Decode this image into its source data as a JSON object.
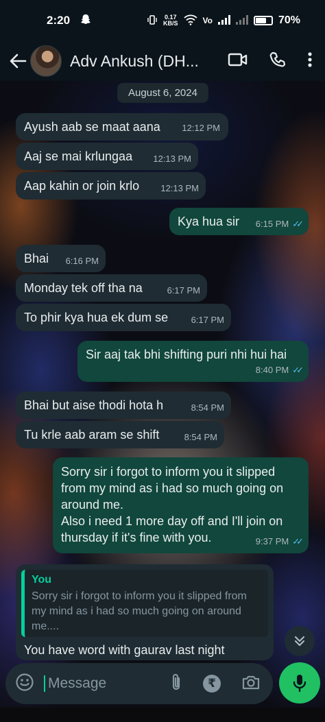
{
  "status_bar": {
    "time": "2:20",
    "snap_icon": "ghost",
    "net_speed_value": "0.17",
    "net_speed_unit": "KB/S",
    "vo_label": "Vo",
    "battery": "70%",
    "battery_level": 0.7
  },
  "header": {
    "contact_name": "Adv Ankush (DH...",
    "icons": [
      "back-arrow",
      "video-call",
      "voice-call",
      "more-options"
    ]
  },
  "date_chip": "August 6, 2024",
  "messages": [
    {
      "dir": "in",
      "text": "Ayush aab se maat aana",
      "time": "12:12 PM"
    },
    {
      "dir": "in",
      "text": "Aaj se mai krlungaa",
      "time": "12:13 PM"
    },
    {
      "dir": "in",
      "text": "Aap kahin or join krlo",
      "time": "12:13 PM"
    },
    {
      "dir": "out",
      "text": "Kya hua sir",
      "time": "6:15 PM",
      "ticks": "✓✓"
    },
    {
      "dir": "in",
      "text": "Bhai",
      "time": "6:16 PM"
    },
    {
      "dir": "in",
      "text": "Monday tek off tha na",
      "time": "6:17 PM"
    },
    {
      "dir": "in",
      "text": "To phir kya hua ek dum se",
      "time": "6:17 PM"
    },
    {
      "dir": "out",
      "text": "Sir aaj tak bhi shifting puri nhi hui hai",
      "time": "8:40 PM",
      "ticks": "✓✓"
    },
    {
      "dir": "in",
      "text": "Bhai but aise thodi hota h",
      "time": "8:54 PM"
    },
    {
      "dir": "in",
      "text": "Tu krle aab aram se shift",
      "time": "8:54 PM"
    },
    {
      "dir": "out",
      "lines": [
        "Sorry sir i forgot to inform you it slipped",
        "from my mind as i had so much going on",
        "around me.",
        "Also i need 1 more day off and I'll join on",
        "thursday if it's fine with you."
      ],
      "time": "9:37 PM",
      "ticks": "✓✓"
    }
  ],
  "reply": {
    "quote_author": "You",
    "quote_lines": [
      "Sorry sir i forgot to inform you it slipped from",
      "my mind as i had so much going on around",
      "me...."
    ],
    "text": "You have word with gaurav last night"
  },
  "composer": {
    "placeholder": "Message",
    "rupee_symbol": "₹",
    "icons": [
      "emoji",
      "attach",
      "payment",
      "camera",
      "mic"
    ]
  },
  "colors": {
    "incoming": "#1f2c33",
    "outgoing": "#11473c",
    "accent": "#21c063",
    "read_ticks": "#53bdeb"
  }
}
